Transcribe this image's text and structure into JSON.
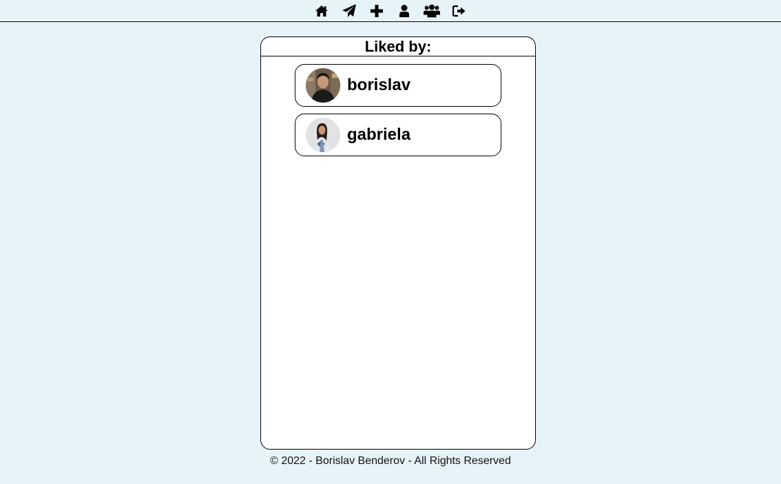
{
  "nav": {
    "items": [
      {
        "icon": "home-icon"
      },
      {
        "icon": "paper-plane-icon"
      },
      {
        "icon": "plus-icon"
      },
      {
        "icon": "user-icon"
      },
      {
        "icon": "users-icon"
      },
      {
        "icon": "sign-out-icon"
      }
    ]
  },
  "likes": {
    "title": "Liked by:",
    "users": [
      {
        "username": "borislav",
        "avatar": "avatar-photo"
      },
      {
        "username": "gabriela",
        "avatar": "avatar-photo"
      }
    ]
  },
  "footer": {
    "text": "© 2022 - Borislav Benderov - All Rights Reserved"
  },
  "colors": {
    "background": "#e6f3f8",
    "card": "#ffffff",
    "border": "#000000"
  }
}
